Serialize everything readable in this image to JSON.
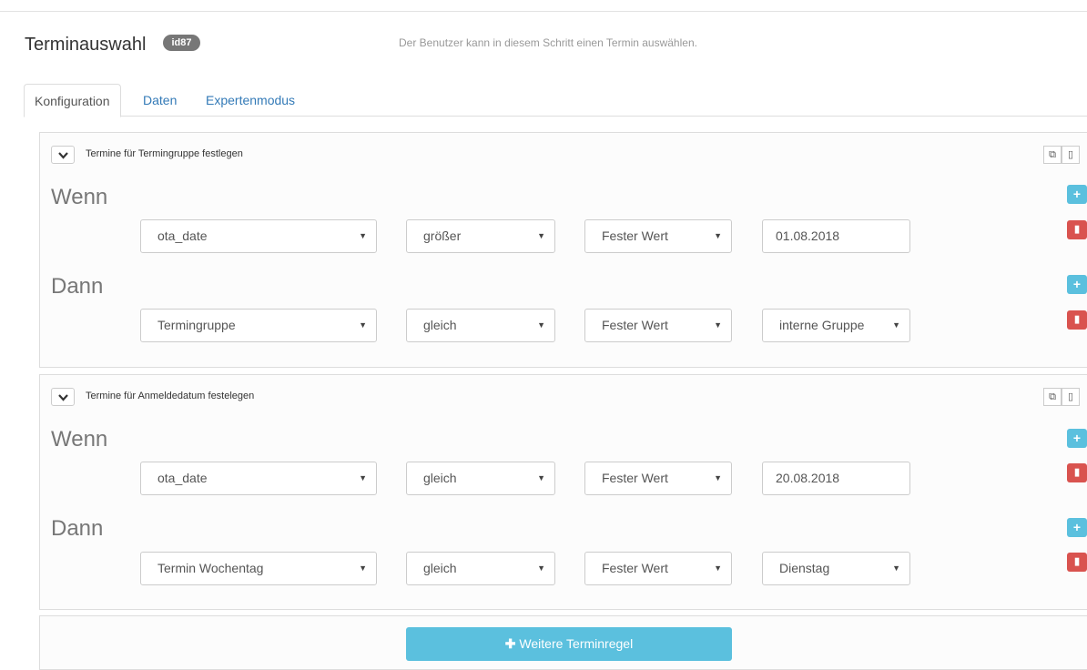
{
  "header": {
    "title": "Terminauswahl",
    "badge": "id87",
    "description": "Der Benutzer kann in diesem Schritt einen Termin auswählen."
  },
  "tabs": [
    {
      "label": "Konfiguration",
      "active": true
    },
    {
      "label": "Daten",
      "active": false
    },
    {
      "label": "Expertenmodus",
      "active": false
    }
  ],
  "rules": [
    {
      "title": "Termine für Termingruppe festlegen",
      "when_label": "Wenn",
      "when": {
        "field": "ota_date",
        "operator": "größer",
        "value_type": "Fester Wert",
        "value": "01.08.2018"
      },
      "then_label": "Dann",
      "then": {
        "field": "Termingruppe",
        "operator": "gleich",
        "value_type": "Fester Wert",
        "value": "interne Gruppe"
      }
    },
    {
      "title": "Termine für Anmeldedatum festelegen",
      "when_label": "Wenn",
      "when": {
        "field": "ota_date",
        "operator": "gleich",
        "value_type": "Fester Wert",
        "value": "20.08.2018"
      },
      "then_label": "Dann",
      "then": {
        "field": "Termin Wochentag",
        "operator": "gleich",
        "value_type": "Fester Wert",
        "value": "Dienstag"
      }
    }
  ],
  "add_rule_button": "Weitere Terminregel",
  "icons": {
    "caret": "▼",
    "plus": "+",
    "copy": "copy-icon",
    "trash": "trash-icon"
  },
  "colors": {
    "info": "#5bc0de",
    "danger": "#d9534f",
    "badge": "#777777",
    "link": "#337ab7"
  }
}
